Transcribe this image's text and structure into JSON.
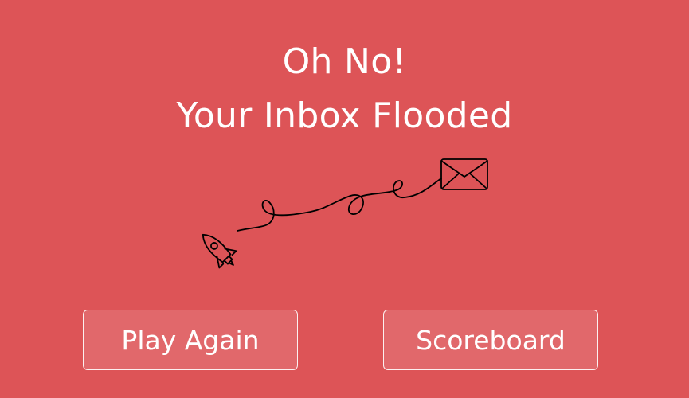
{
  "screen": {
    "heading_line1": "Oh No!",
    "heading_line2": "Your Inbox Flooded"
  },
  "illustration": {
    "rocket_icon": "rocket-icon",
    "envelope_icon": "envelope-icon",
    "stroke_color": "#000000"
  },
  "actions": {
    "play_again_label": "Play Again",
    "scoreboard_label": "Scoreboard"
  },
  "theme": {
    "background": "#dd5457",
    "text_color": "#ffffff"
  }
}
